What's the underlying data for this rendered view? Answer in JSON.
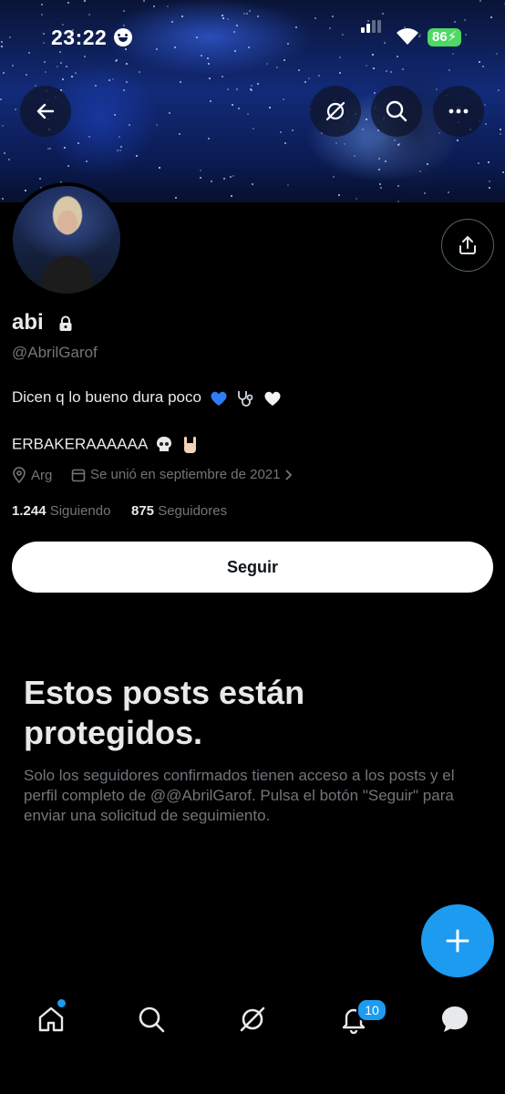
{
  "status_bar": {
    "time": "23:22",
    "battery": "86"
  },
  "profile": {
    "name": "abi",
    "handle": "@AbrilGarof",
    "bio_line1": "Dicen q lo bueno dura poco",
    "bio_line2": "ERBAKERAAAAAA",
    "location": "Arg",
    "joined": "Se unió en septiembre de 2021",
    "following_count": "1.244",
    "following_label": "Siguiendo",
    "followers_count": "875",
    "followers_label": "Seguidores"
  },
  "actions": {
    "follow_label": "Seguir"
  },
  "protected": {
    "title": "Estos posts están protegidos.",
    "text": "Solo los seguidores confirmados tienen acceso a los posts y el perfil completo de @@AbrilGarof. Pulsa el botón \"Seguir\" para enviar una solicitud de seguimiento."
  },
  "nav": {
    "notifications_badge": "10"
  },
  "icons": [
    "back-arrow-icon",
    "grok-icon",
    "search-icon",
    "more-icon",
    "share-icon",
    "lock-icon",
    "location-icon",
    "calendar-icon",
    "chevron-right-icon",
    "plus-icon",
    "home-icon",
    "notifications-icon",
    "messages-icon"
  ],
  "colors": {
    "accent": "#1d9bf0",
    "muted": "#71767b",
    "text": "#e7e9ea",
    "battery": "#4cd964"
  }
}
